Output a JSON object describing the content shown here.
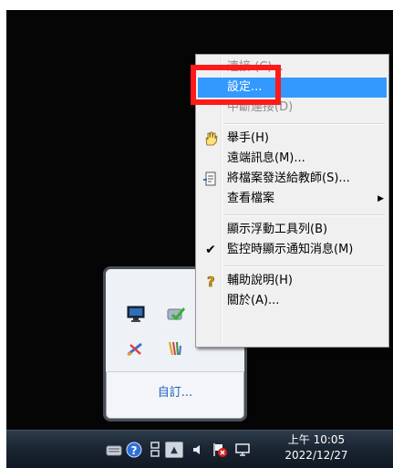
{
  "menu": {
    "items": [
      {
        "label": "連接 (C)...",
        "disabled": true
      },
      {
        "label": "設定...",
        "highlight": true
      },
      {
        "label": "中斷連接(D)",
        "disabled": true
      },
      {
        "label": "舉手(H)",
        "icon": "hand-icon"
      },
      {
        "label": "遠端訊息(M)..."
      },
      {
        "label": "將檔案發送給教師(S)...",
        "icon": "document-send-icon"
      },
      {
        "label": "查看檔案",
        "submenu": true
      },
      {
        "label": "顯示浮動工具列(B)"
      },
      {
        "label": "監控時顯示通知消息(M)",
        "checked": true
      },
      {
        "label": "輔助說明(H)",
        "icon": "help-icon"
      },
      {
        "label": "關於(A)..."
      }
    ],
    "submenu_arrow": "▶",
    "checkmark": "✔"
  },
  "tray_popup": {
    "customize_label": "自訂...",
    "icons": [
      "monitor-icon",
      "checkmark-app-icon",
      "pen-tool-icon",
      "signal-icon"
    ]
  },
  "taskbar": {
    "icons": [
      "keyboard-icon",
      "help-circle-icon",
      "network-icon",
      "show-hidden-icons-button",
      "speaker-icon",
      "flag-icon",
      "display-icon"
    ],
    "clock_time": "上午 10:05",
    "clock_date": "2022/12/27",
    "show_hidden_glyph": "▲"
  },
  "colors": {
    "highlight": "#3399ff",
    "annotation": "#ff1a1a",
    "link": "#1d5fb8"
  }
}
